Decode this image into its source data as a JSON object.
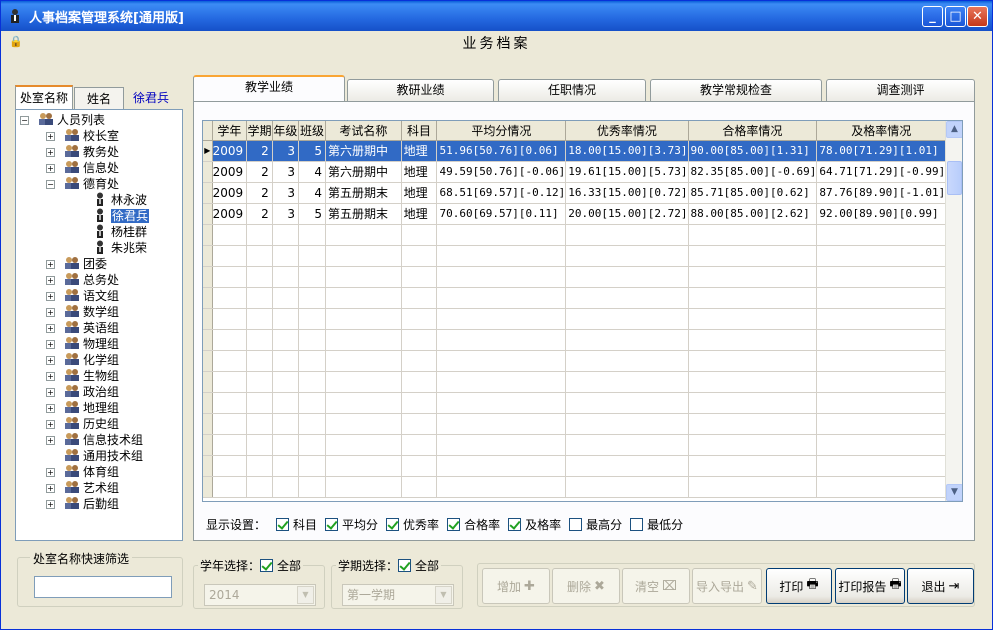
{
  "window": {
    "title": "人事档案管理系统[通用版]",
    "min": "_",
    "max": "□",
    "close": "✕"
  },
  "page_title": "业务档案",
  "left_tabs": {
    "dept": "处室名称",
    "name": "姓名",
    "user": "徐君兵"
  },
  "tree": {
    "root": "人员列表",
    "nodes": [
      {
        "label": "校长室",
        "expand": "+"
      },
      {
        "label": "教务处",
        "expand": "+"
      },
      {
        "label": "信息处",
        "expand": "+"
      },
      {
        "label": "德育处",
        "expand": "−",
        "children": [
          "林永波",
          "徐君兵",
          "杨桂群",
          "朱兆荣"
        ],
        "selected": "徐君兵"
      },
      {
        "label": "团委",
        "expand": "+"
      },
      {
        "label": "总务处",
        "expand": "+"
      },
      {
        "label": "语文组",
        "expand": "+"
      },
      {
        "label": "数学组",
        "expand": "+"
      },
      {
        "label": "英语组",
        "expand": "+"
      },
      {
        "label": "物理组",
        "expand": "+"
      },
      {
        "label": "化学组",
        "expand": "+"
      },
      {
        "label": "生物组",
        "expand": "+"
      },
      {
        "label": "政治组",
        "expand": "+"
      },
      {
        "label": "地理组",
        "expand": "+"
      },
      {
        "label": "历史组",
        "expand": "+"
      },
      {
        "label": "信息技术组",
        "expand": "+"
      },
      {
        "label": "通用技术组",
        "expand": ""
      },
      {
        "label": "体育组",
        "expand": "+"
      },
      {
        "label": "艺术组",
        "expand": "+"
      },
      {
        "label": "后勤组",
        "expand": "+"
      }
    ]
  },
  "filter": {
    "label": "处室名称快速筛选",
    "value": ""
  },
  "tabs": [
    "教学业绩",
    "教研业绩",
    "任职情况",
    "教学常规检查",
    "调查测评"
  ],
  "grid": {
    "columns": [
      "学年",
      "学期",
      "年级",
      "班级",
      "考试名称",
      "科目",
      "平均分情况",
      "优秀率情况",
      "合格率情况",
      "及格率情况"
    ],
    "rows": [
      [
        "2009",
        "2",
        "3",
        "5",
        "第六册期中",
        "地理",
        "51.96[50.76][0.06]",
        "18.00[15.00][3.73]",
        "90.00[85.00][1.31]",
        "78.00[71.29][1.01]"
      ],
      [
        "2009",
        "2",
        "3",
        "4",
        "第六册期中",
        "地理",
        "49.59[50.76][-0.06]",
        "19.61[15.00][5.73]",
        "82.35[85.00][-0.69]",
        "64.71[71.29][-0.99]"
      ],
      [
        "2009",
        "2",
        "3",
        "4",
        "第五册期末",
        "地理",
        "68.51[69.57][-0.12]",
        "16.33[15.00][0.72]",
        "85.71[85.00][0.62]",
        "87.76[89.90][-1.01]"
      ],
      [
        "2009",
        "2",
        "3",
        "5",
        "第五册期末",
        "地理",
        "70.60[69.57][0.11]",
        "20.00[15.00][2.72]",
        "88.00[85.00][2.62]",
        "92.00[89.90][0.99]"
      ]
    ],
    "selected_row": 0,
    "indicator": "▶"
  },
  "display_settings": {
    "label": "显示设置：",
    "options": [
      {
        "label": "科目",
        "checked": true
      },
      {
        "label": "平均分",
        "checked": true
      },
      {
        "label": "优秀率",
        "checked": true
      },
      {
        "label": "合格率",
        "checked": true
      },
      {
        "label": "及格率",
        "checked": true
      },
      {
        "label": "最高分",
        "checked": false
      },
      {
        "label": "最低分",
        "checked": false
      }
    ]
  },
  "year_select": {
    "label": "学年选择：",
    "all_label": "全部",
    "all_checked": true,
    "value": "2014"
  },
  "term_select": {
    "label": "学期选择：",
    "all_label": "全部",
    "all_checked": true,
    "value": "第一学期"
  },
  "actions": {
    "add": "增加",
    "add_icon": "✚",
    "delete": "删除",
    "delete_icon": "✖",
    "clear": "清空",
    "clear_icon": "⌧",
    "import_export": "导入导出",
    "import_export_icon": "✎",
    "print": "打印",
    "print_icon": "🖶",
    "print_report": "打印报告",
    "print_report_icon": "🖶",
    "exit": "退出",
    "exit_icon": "⇥"
  }
}
